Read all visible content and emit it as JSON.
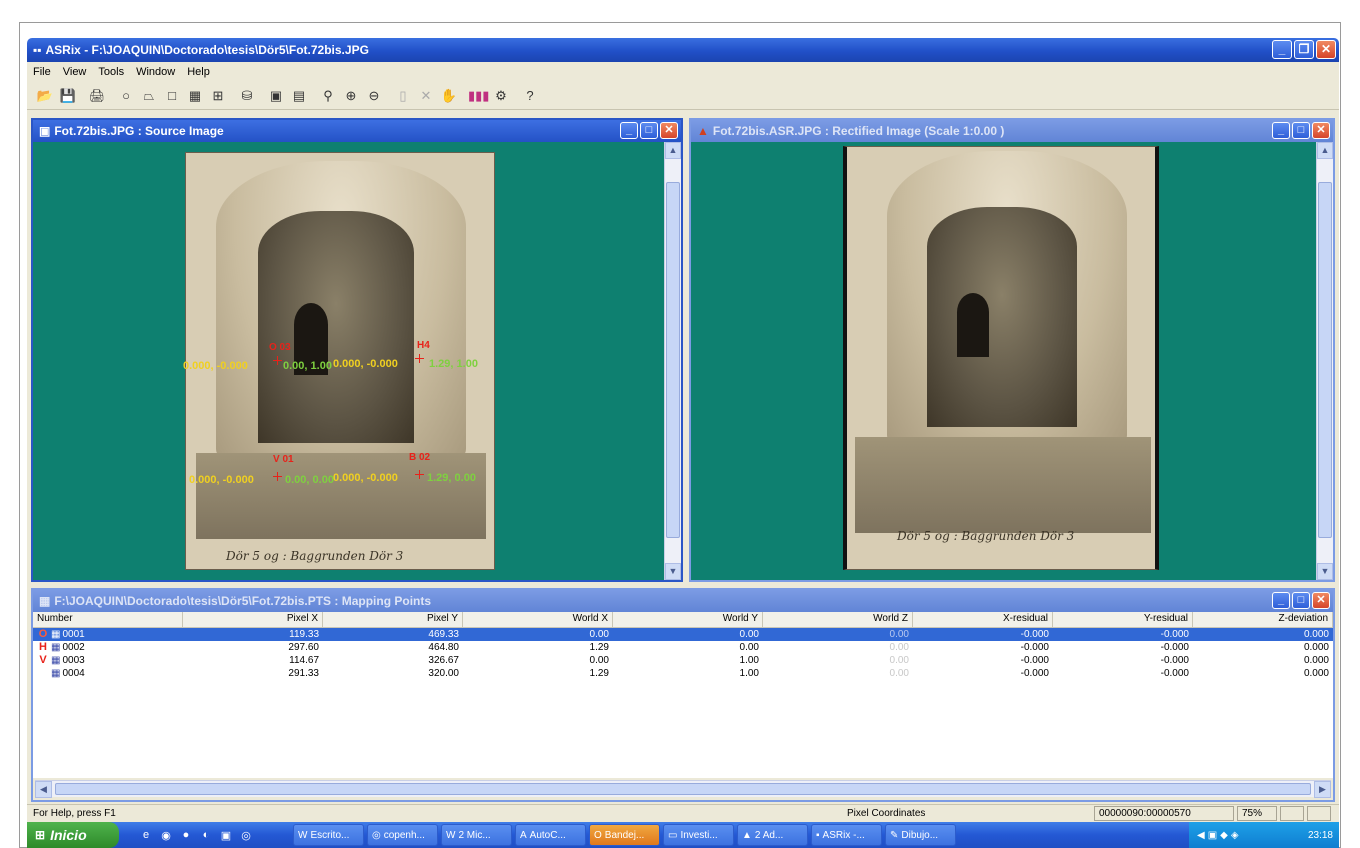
{
  "app": {
    "title": "ASRix - F:\\JOAQUIN\\Doctorado\\tesis\\Dör5\\Fot.72bis.JPG",
    "menu": [
      "File",
      "View",
      "Tools",
      "Window",
      "Help"
    ]
  },
  "toolbar": {
    "icons": [
      "open-icon",
      "save-icon",
      "print-icon",
      "circle-icon",
      "trapezoid-icon",
      "rectangle-icon",
      "grid-icon",
      "split-grid-icon",
      "database-icon",
      "camera-icon",
      "camera-sync-icon",
      "zoom-fit-icon",
      "zoom-in-icon",
      "zoom-out-icon",
      "page-icon",
      "delete-icon",
      "pan-icon",
      "color-bars-icon",
      "settings-icon",
      "help-icon"
    ]
  },
  "source_window": {
    "title": "Fot.72bis.JPG : Source Image",
    "caption": "Dör 5 og : Baggrunden Dör 3",
    "markers": {
      "o_label": "O 03",
      "h_label": "H4",
      "v_label": "V 01",
      "b_label": "B 02",
      "coord1": "0.000, -0.000",
      "coord2": "0.000, -0.000",
      "coord3": "0.000, -0.000",
      "coord4": "0.000, -0.000",
      "green1": "0.00, 1.00",
      "green2": "1.29, 1.00",
      "green3": "0.00, 0.00",
      "green4": "1.29, 0.00"
    }
  },
  "rectified_window": {
    "title": "Fot.72bis.ASR.JPG : Rectified Image (Scale 1:0.00 )",
    "caption": "Dör 5 og : Baggrunden Dör 3"
  },
  "points_window": {
    "title": "F:\\JOAQUIN\\Doctorado\\tesis\\Dör5\\Fot.72bis.PTS : Mapping Points",
    "columns": [
      "Number",
      "Pixel X",
      "Pixel Y",
      "World X",
      "World Y",
      "World Z",
      "X-residual",
      "Y-residual",
      "Z-deviation"
    ],
    "rows": [
      {
        "marker": "O",
        "number": "0001",
        "pixel_x": "119.33",
        "pixel_y": "469.33",
        "world_x": "0.00",
        "world_y": "0.00",
        "world_z": "0.00",
        "x_res": "-0.000",
        "y_res": "-0.000",
        "z_dev": "0.000",
        "selected": true
      },
      {
        "marker": "H",
        "number": "0002",
        "pixel_x": "297.60",
        "pixel_y": "464.80",
        "world_x": "1.29",
        "world_y": "0.00",
        "world_z": "0.00",
        "x_res": "-0.000",
        "y_res": "-0.000",
        "z_dev": "0.000",
        "selected": false
      },
      {
        "marker": "V",
        "number": "0003",
        "pixel_x": "114.67",
        "pixel_y": "326.67",
        "world_x": "0.00",
        "world_y": "1.00",
        "world_z": "0.00",
        "x_res": "-0.000",
        "y_res": "-0.000",
        "z_dev": "0.000",
        "selected": false
      },
      {
        "marker": "",
        "number": "0004",
        "pixel_x": "291.33",
        "pixel_y": "320.00",
        "world_x": "1.29",
        "world_y": "1.00",
        "world_z": "0.00",
        "x_res": "-0.000",
        "y_res": "-0.000",
        "z_dev": "0.000",
        "selected": false
      }
    ]
  },
  "statusbar": {
    "help": "For Help, press F1",
    "mode": "Pixel Coordinates",
    "coords": "00000090:00000570",
    "zoom": "75%"
  },
  "taskbar": {
    "start": "Inicio",
    "tasks": [
      {
        "icon": "word-icon",
        "label": "Escrito..."
      },
      {
        "icon": "chrome-icon",
        "label": "copenh..."
      },
      {
        "icon": "word-icon",
        "label": "2 Mic..."
      },
      {
        "icon": "autocad-icon",
        "label": "AutoC..."
      },
      {
        "icon": "outlook-icon",
        "label": "Bandej..."
      },
      {
        "icon": "folder-icon",
        "label": "Investi..."
      },
      {
        "icon": "acrobat-icon",
        "label": "2 Ad..."
      },
      {
        "icon": "asrix-icon",
        "label": "ASRix -..."
      },
      {
        "icon": "paint-icon",
        "label": "Dibujo..."
      }
    ],
    "clock": "23:18"
  },
  "colors": {
    "titlebar": "#2452c6",
    "canvas": "#0e8070",
    "selection": "#3168d5",
    "marker_red": "#e8221a",
    "marker_yellow": "#f0d020",
    "marker_green": "#7fd040"
  }
}
